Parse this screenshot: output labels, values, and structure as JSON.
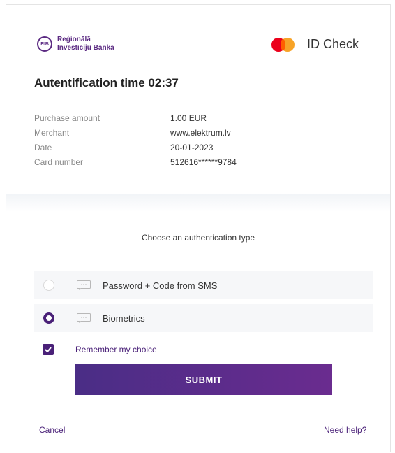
{
  "bank": {
    "logo_mark": "RIB",
    "name_line1": "Reģionālā",
    "name_line2": "Investīciju Banka",
    "brand_color": "#5b2a82"
  },
  "id_check": {
    "label": "ID Check"
  },
  "auth": {
    "title": "Autentification time",
    "timer": "02:37"
  },
  "details": [
    {
      "label": "Purchase amount",
      "value": "1.00 EUR"
    },
    {
      "label": "Merchant",
      "value": "www.elektrum.lv"
    },
    {
      "label": "Date",
      "value": "20-01-2023"
    },
    {
      "label": "Card number",
      "value": "512616******9784"
    }
  ],
  "choose_label": "Choose an authentication type",
  "options": [
    {
      "label": "Password + Code from SMS",
      "selected": false,
      "icon": "message-icon"
    },
    {
      "label": "Biometrics",
      "selected": true,
      "icon": "message-icon"
    }
  ],
  "remember": {
    "label": "Remember my choice",
    "checked": true
  },
  "submit_label": "SUBMIT",
  "cancel_label": "Cancel",
  "help_label": "Need help?",
  "colors": {
    "accent": "#4a2178",
    "button_gradient_start": "#4a2d86",
    "button_gradient_end": "#6a2c8f"
  }
}
